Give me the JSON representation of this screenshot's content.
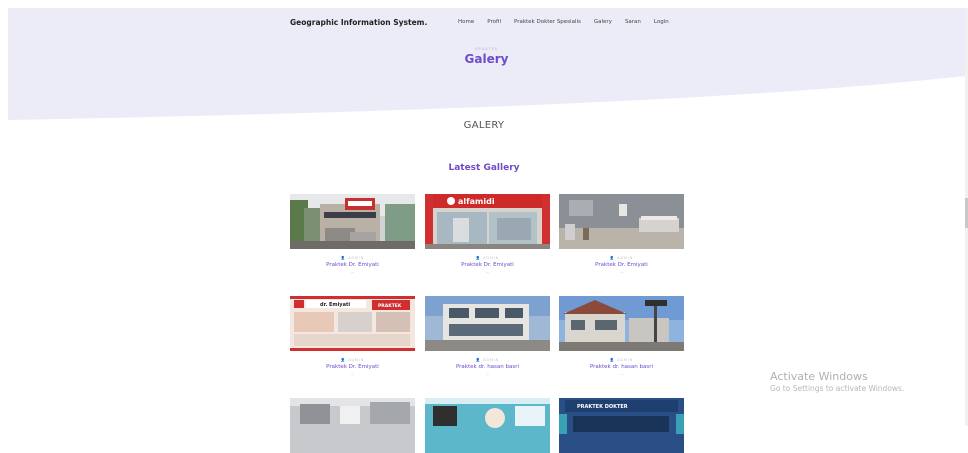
{
  "header": {
    "brand": "Geographic Information System.",
    "nav": [
      "Home",
      "Profil",
      "Praktek Dokter Spesialis",
      "Galery",
      "Saran",
      "Login"
    ],
    "kicker": "UPDATES",
    "title": "Galery"
  },
  "section_title": "GALERY",
  "latest_title": "Latest Gallery",
  "cards": [
    {
      "author": "ADMIN",
      "title": "Praktek Dr. Emiyati",
      "dash": "—"
    },
    {
      "author": "ADMIN",
      "title": "Praktek Dr. Emiyati",
      "dash": "—"
    },
    {
      "author": "ADMIN",
      "title": "Praktek Dr. Emiyati",
      "dash": "—"
    },
    {
      "author": "ADMIN",
      "title": "Praktek Dr. Emiyati",
      "dash": "—"
    },
    {
      "author": "ADMIN",
      "title": "Praktek dr. hasan basri",
      "dash": "—"
    },
    {
      "author": "ADMIN",
      "title": "Praktek dr. hasan basri",
      "dash": "—"
    },
    {
      "author": "",
      "title": "",
      "dash": ""
    },
    {
      "author": "",
      "title": "",
      "dash": ""
    },
    {
      "author": "",
      "title": "",
      "dash": ""
    }
  ],
  "thumb_signs": {
    "alfamidi": "alfamidi",
    "banner_name": "dr. Emiyati",
    "banner_right": "PRAKTEK",
    "sign_top": "PRAKTEK DOKTER"
  },
  "watermark": {
    "line1": "Activate Windows",
    "line2": "Go to Settings to activate Windows."
  },
  "colors": {
    "accent": "#6d4bc9",
    "hero_bg": "#ecebf8"
  }
}
